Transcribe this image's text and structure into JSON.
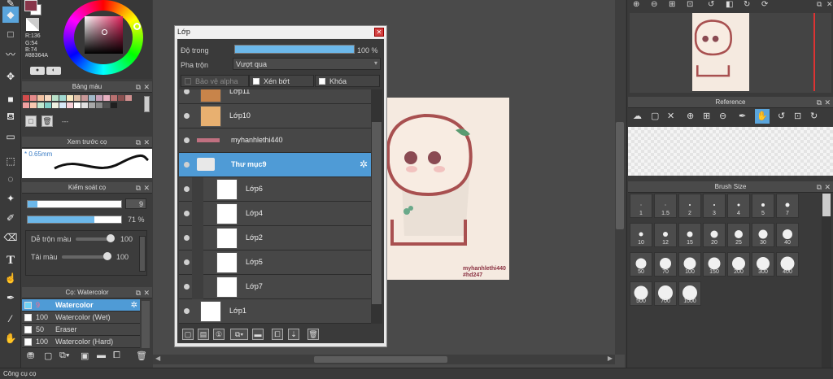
{
  "color": {
    "r": "R:136",
    "g": "G:54",
    "b": "B:74",
    "hex": "#88364A",
    "current": "#88364a"
  },
  "palette_panel": {
    "title": "Bảng màu",
    "label": "---"
  },
  "brush_preview": {
    "title": "Xem trước cọ",
    "size": "0.65mm"
  },
  "brush_control": {
    "title": "Kiểm soát cọ",
    "size_value": "9",
    "opacity_value": "71 %",
    "opacity_fraction": 0.71,
    "blend_label": "Dễ trộn màu",
    "blend_value": "100",
    "blend_fraction": 1.0,
    "paint_label": "Tải màu",
    "paint_value": "100",
    "paint_fraction": 1.0
  },
  "brush_list": {
    "title": "Cọ: Watercolor",
    "items": [
      {
        "size": "9",
        "name": "Watercolor",
        "selected": true
      },
      {
        "size": "100",
        "name": "Watercolor (Wet)",
        "selected": false
      },
      {
        "size": "50",
        "name": "Eraser",
        "selected": false
      },
      {
        "size": "100",
        "name": "Watercolor (Hard)",
        "selected": false
      }
    ]
  },
  "status_bar": {
    "text": "Công cụ cọ"
  },
  "layer_window": {
    "title": "Lớp",
    "opacity_label": "Độ trong",
    "opacity_value": "100 %",
    "blend_label": "Pha trộn",
    "blend_value": "Vượt qua",
    "protect_alpha": "Bảo vệ alpha",
    "clip": "Xén bớt",
    "lock": "Khóa",
    "layers": [
      {
        "name": "Lớp11",
        "indent": false,
        "selected": false
      },
      {
        "name": "Lớp10",
        "indent": false,
        "selected": false
      },
      {
        "name": "myhanhlethi440",
        "indent": false,
        "selected": false
      },
      {
        "name": "Thư mục9",
        "indent": false,
        "selected": true,
        "folder": true
      },
      {
        "name": "Lớp6",
        "indent": true,
        "selected": false
      },
      {
        "name": "Lớp4",
        "indent": true,
        "selected": false
      },
      {
        "name": "Lớp2",
        "indent": true,
        "selected": false
      },
      {
        "name": "Lớp5",
        "indent": true,
        "selected": false
      },
      {
        "name": "Lớp7",
        "indent": true,
        "selected": false
      },
      {
        "name": "Lớp1",
        "indent": false,
        "selected": false
      }
    ]
  },
  "canvas": {
    "signature_line1": "myhanhlethi440",
    "signature_line2": "#hd247"
  },
  "reference": {
    "title": "Reference"
  },
  "brush_size": {
    "title": "Brush Size",
    "sizes": [
      "1",
      "1.5",
      "2",
      "3",
      "4",
      "5",
      "7",
      "10",
      "12",
      "15",
      "20",
      "25",
      "30",
      "40",
      "50",
      "70",
      "100",
      "150",
      "200",
      "300",
      "400",
      "500",
      "700",
      "1000"
    ]
  },
  "accent_color": "#4f9bd6"
}
